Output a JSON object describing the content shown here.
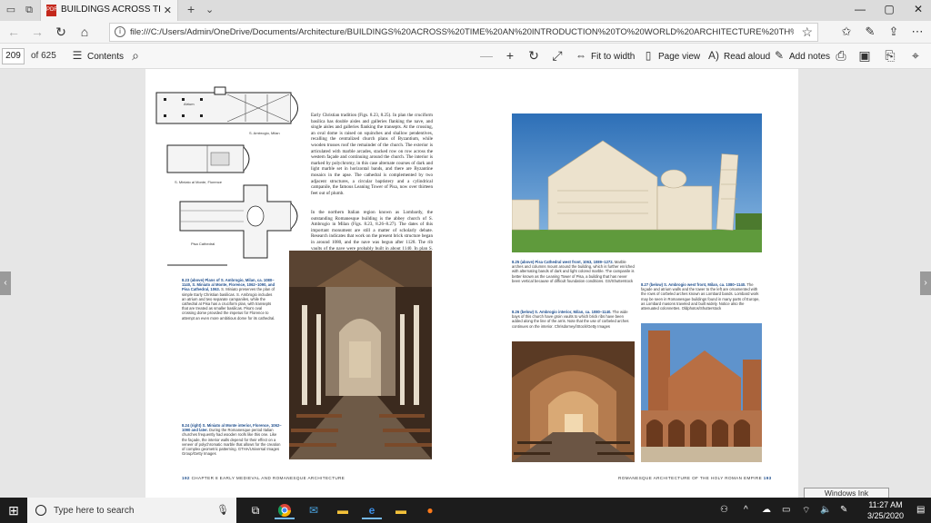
{
  "browser": {
    "tab_title": "BUILDINGS ACROSS TIM",
    "url": "file:///C:/Users/Admin/OneDrive/Documents/Architecture/BUILDINGS%20ACROSS%20TIME%20AN%20INTRODUCTION%20TO%20WORLD%20ARCHITECTURE%20TH%20EDITION%20PDF.pdf"
  },
  "pdf_toolbar": {
    "current_page": "209",
    "page_count": "of 625",
    "contents_label": "Contents",
    "fit_to_width_label": "Fit to width",
    "page_view_label": "Page view",
    "read_aloud_label": "Read aloud",
    "add_notes_label": "Add notes"
  },
  "left_page": {
    "plan_labels": {
      "atrium": "Atrium",
      "s_ambrogio": "S. Ambrogio, Milan",
      "s_miniato": "S. Miniato al Monte, Florence",
      "pisa": "Pisa Cathedral"
    },
    "body_text": "Early Christian tradition (Figs. 8.23, 8.25). In plan the cruciform basilica has double aisles and galleries flanking the nave, and single aisles and galleries flanking the transepts. At the crossing, an oval dome is raised on squinches and shallow pendentives, recalling the centralized church plans of Byzantium, while wooden trusses roof the remainder of the church. The exterior is articulated with marble arcades, stacked row on row across the western façade and continuing around the church. The interior is marked by polychromy, in this case alternate courses of dark and light marble set in horizontal bands, and there are Byzantine mosaics in the apse. The cathedral is complemented by two adjacent structures, a circular baptistery and a cylindrical campanile, the famous Leaning Tower of Pisa, now over thirteen feet out of plumb.",
    "body_text_2": "In the northern Italian region known as Lombardy, the outstanding Romanesque building is the abbey church of S. Ambrogio in Milan (Figs. 8.23, 8.26–8.27). The dates of this important monument are still a matter of scholarly debate. Research indicates that work on the present brick structure began in around 1080, and the nave was begun after 1128. The rib vaults of the nave were probably built in about 1140. In plan S. Ambrogio continues Early Christian practice.",
    "caption_823_head": "8.23 (above) Plans of S. Ambrogio, Milan, ca. 1080–1140, S. Miniato al Monte, Florence, 1062–1090, and Pisa Cathedral, 1063.",
    "caption_823_body": "S. Miniato preserves the plan of simple Early Christian basilicas. S. Ambrogio includes an atrium and two separate campaniles, while the cathedral at Pisa has a cruciform plan, with transepts that are treated as smaller basilicas. Pisa's oval crossing dome provided the impetus for Florence to attempt an even more ambitious dome for its cathedral.",
    "caption_824_head": "8.24 (right) S. Miniato al Monte interior, Florence, 1062–1090 and later.",
    "caption_824_body": "During the Romanesque period Italian churches frequently had wooden roofs like this one. Like the façade, the interior walls depend for their effect on a veneer of polychromatic marble that allows for the creation of complex geometric patterning.",
    "caption_824_credit": "GTHA/Universal Images Group/Getty Images",
    "footer_page": "192",
    "footer_text": "CHAPTER 8 EARLY MEDIEVAL AND ROMANESQUE ARCHITECTURE"
  },
  "right_page": {
    "caption_825_head": "8.25 (above) Pisa Cathedral west front, 1063, 1089–1272.",
    "caption_825_body": "Marble arches and columns mount around the building, which is further enriched with alternating bands of dark and light colored marble. The campanile is better known as the Leaning Tower of Pisa, a building that has never been vertical because of difficult foundation conditions.",
    "caption_825_credit": "GS/Shutterstock",
    "caption_826_head": "8.26 (below) S. Ambrogio interior, Milan, ca. 1080–1140.",
    "caption_826_body": "The wide bays of this church have groin vaults to which brick ribs have been added along the line of the arris. Note that the use of corbeled arches continues on the interior.",
    "caption_826_credit": "Chrisdorney/iStock/Getty Images",
    "caption_827_head": "8.27 (below) S. Ambrogio west front, Milan, ca. 1080–1140.",
    "caption_827_body": "The façade and atrium walls and the tower to the left are ornamented with the rows of corbeled arches known as Lombard bands. Lombard work may be seen in Romanesque buildings found in many parts of Europe, as Lombard masons traveled and built widely. Notice also the attenuated colonnettes.",
    "caption_827_credit": "Oldphotos/Shutterstock",
    "footer_text": "ROMANESQUE ARCHITECTURE OF THE HOLY ROMAN EMPIRE",
    "footer_page": "193"
  },
  "ink_workspace_label": "Windows Ink Workspace",
  "taskbar": {
    "search_placeholder": "Type here to search",
    "time": "11:27 AM",
    "date": "3/25/2020"
  },
  "colors": {
    "accent_blue": "#1f4e8c",
    "pdf_red": "#c4281c",
    "taskbar": "#1c1c1c"
  }
}
